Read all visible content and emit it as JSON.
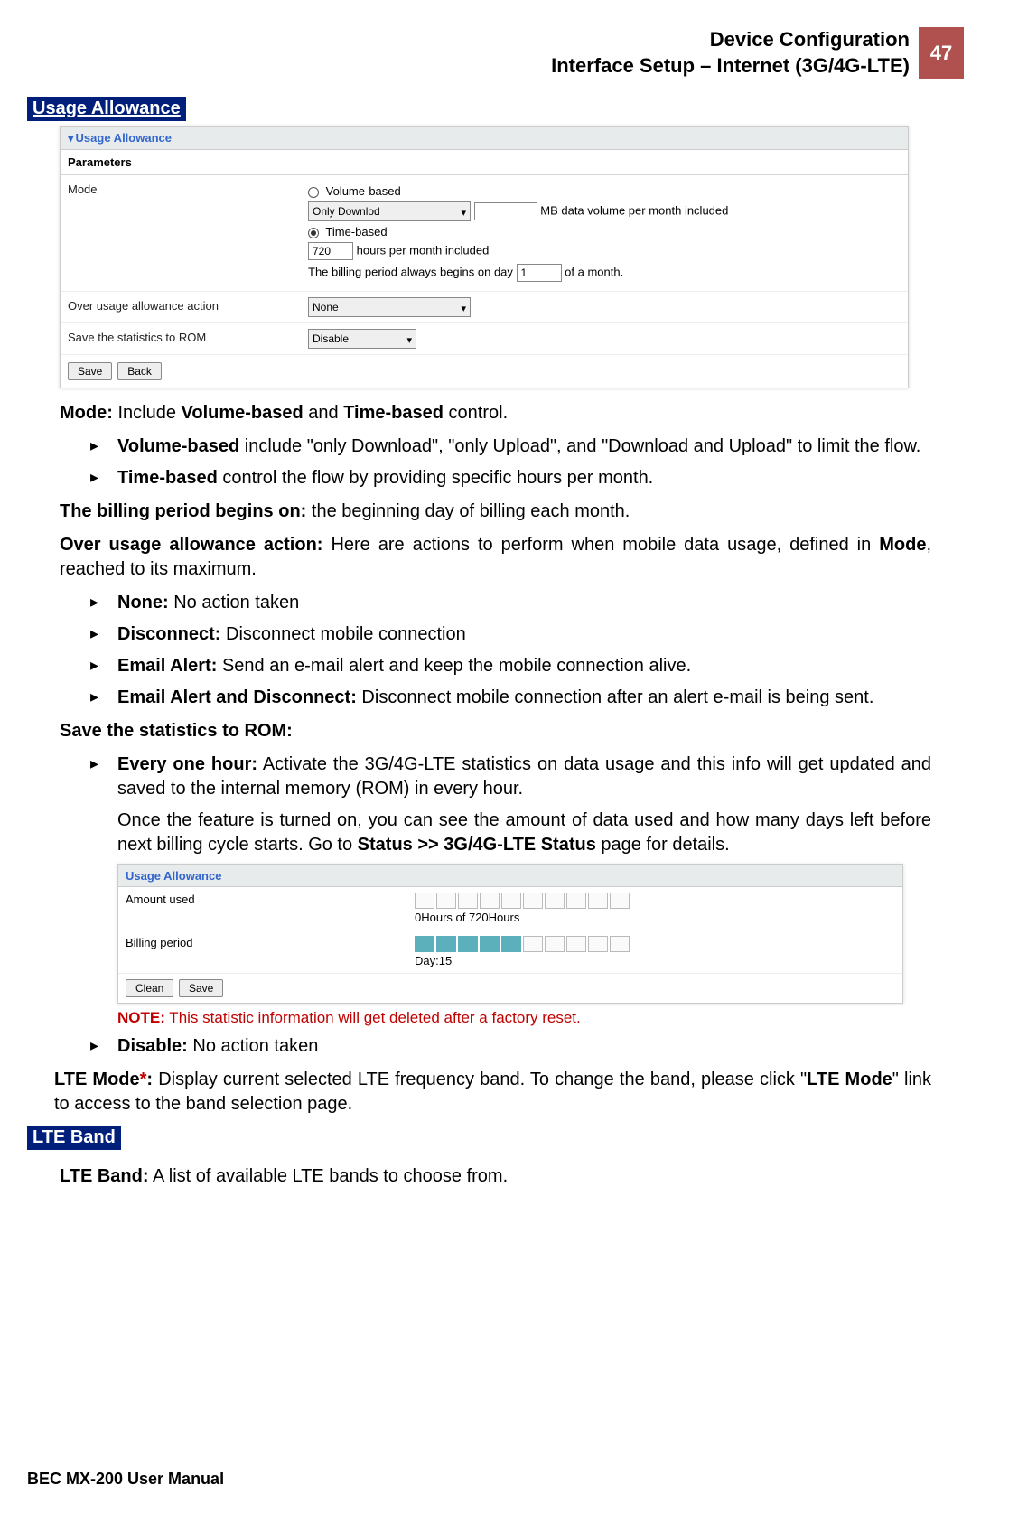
{
  "header": {
    "title_line1": "Device Configuration",
    "title_line2": "Interface Setup – Internet (3G/4G-LTE)",
    "page_number": "47"
  },
  "section_usage_allowance": "Usage Allowance",
  "shot1": {
    "panel_title": "Usage Allowance",
    "parameters": "Parameters",
    "mode_label": "Mode",
    "volume_based": "Volume-based",
    "only_download": "Only Downlod",
    "mb_suffix": "MB data volume per month included",
    "time_based": "Time-based",
    "hours_value": "720",
    "hours_suffix": "hours per month included",
    "billing_prefix": "The billing period always begins on day",
    "billing_day": "1",
    "billing_suffix": "of a month.",
    "over_usage_label": "Over usage allowance action",
    "over_usage_value": "None",
    "save_stats_label": "Save the statistics to ROM",
    "save_stats_value": "Disable",
    "btn_save": "Save",
    "btn_back": "Back"
  },
  "body": {
    "mode_intro_1": "Mode:",
    "mode_intro_2": " Include ",
    "mode_intro_3": "Volume-based",
    "mode_intro_4": " and ",
    "mode_intro_5": "Time-based",
    "mode_intro_6": " control.",
    "vol_b": "Volume-based",
    "vol_txt": " include \"only Download\", \"only Upload\", and \"Download and Upload\" to limit the flow.",
    "time_b": "Time-based",
    "time_txt": " control the flow by providing specific hours per month.",
    "billing_b": "The billing period begins on:",
    "billing_txt": " the beginning day of billing each month.",
    "over_b": "Over usage allowance action:",
    "over_txt1": " Here are actions to perform when mobile data usage, defined in ",
    "over_txt2": "Mode",
    "over_txt3": ", reached to its maximum.",
    "none_b": "None:",
    "none_t": " No action taken",
    "disc_b": "Disconnect:",
    "disc_t": " Disconnect mobile connection",
    "email_b": "Email Alert:",
    "email_t": " Send an e-mail alert and keep the mobile connection alive.",
    "emaild_b": "Email Alert and Disconnect:",
    "emaild_t": " Disconnect mobile connection after an alert e-mail is being sent.",
    "savestats_b": "Save the statistics to ROM:",
    "every_b": "Every one hour:",
    "every_t": " Activate the 3G/4G-LTE statistics on data usage and this info will get updated and saved to the internal memory (ROM) in every hour.",
    "every_p2a": "Once the feature is turned on, you can see the amount of data used and how many days left before next billing cycle starts.  Go to ",
    "every_p2b": "Status >> 3G/4G-LTE Status",
    "every_p2c": " page for details."
  },
  "shot2": {
    "panel_title": "Usage Allowance",
    "amount_label": "Amount used",
    "amount_text": "0Hours of 720Hours",
    "billing_label": "Billing period",
    "billing_text": "Day:15",
    "btn_clean": "Clean",
    "btn_save": "Save"
  },
  "note_label": "NOTE:",
  "note_text": " This statistic information will get deleted after a factory reset.",
  "disable_b": "Disable:",
  "disable_t": " No action taken",
  "lte_mode_b": "LTE Mode",
  "lte_mode_star": "*",
  "lte_mode_colon": ":",
  "lte_mode_t1": " Display current selected LTE frequency band.  To change the band, please click \"",
  "lte_mode_t2": "LTE Mode",
  "lte_mode_t3": "\" link to access to the band selection page.",
  "section_lte_band": "LTE Band",
  "lte_band_b": "LTE Band:",
  "lte_band_t": " A list of available LTE bands to choose from.",
  "footer": "BEC MX-200 User Manual"
}
